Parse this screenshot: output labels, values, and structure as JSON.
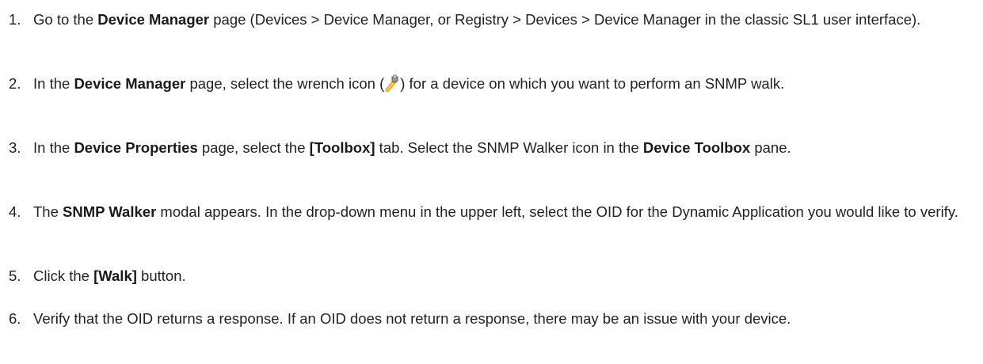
{
  "steps": [
    {
      "number": "1.",
      "t1": "Go to the ",
      "b1": "Device Manager",
      "t2": " page (Devices > Device Manager, or Registry > Devices > Device Manager in the classic SL1 user interface)."
    },
    {
      "number": "2.",
      "t1": "In the ",
      "b1": "Device Manager",
      "t2": " page, select the wrench icon (",
      "icon": "wrench-icon",
      "t3": ") for a device on which you want to perform an SNMP walk."
    },
    {
      "number": "3.",
      "t1": "In the ",
      "b1": "Device Properties",
      "t2": " page, select the ",
      "b2": "[Toolbox]",
      "t3": " tab. Select the SNMP Walker icon in the ",
      "b3": "Device Toolbox",
      "t4": " pane."
    },
    {
      "number": "4.",
      "t1": "The ",
      "b1": "SNMP Walker",
      "t2": " modal appears. In the drop-down menu in the upper left, select the OID for the Dynamic Application you would like to verify."
    },
    {
      "number": "5.",
      "t1": "Click the ",
      "b1": "[Walk]",
      "t2": " button."
    },
    {
      "number": "6.",
      "t1": "Verify that the OID returns a response. If an OID does not return a response, there may be an issue with your device."
    }
  ]
}
